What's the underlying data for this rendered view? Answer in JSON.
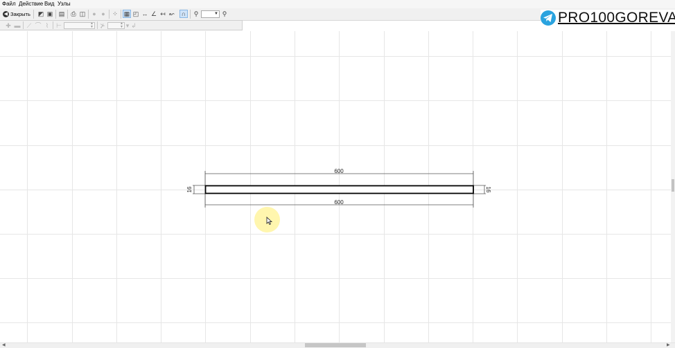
{
  "menu": {
    "file": "Файл",
    "action": "Действие",
    "view": "Вид",
    "nodes": "Узлы"
  },
  "toolbar": {
    "close_label": "Закрыть"
  },
  "watermark": {
    "text": "PRO100GOREVA"
  },
  "drawing": {
    "top_dimension": "600",
    "bottom_dimension": "600",
    "left_dimension": "16",
    "right_dimension": "16"
  },
  "icons": [
    "close-icon",
    "open-icon",
    "save-icon",
    "print-icon",
    "grid-icon",
    "zoom-in-icon",
    "zoom-out-icon",
    "telegram-icon",
    "cursor-icon"
  ]
}
